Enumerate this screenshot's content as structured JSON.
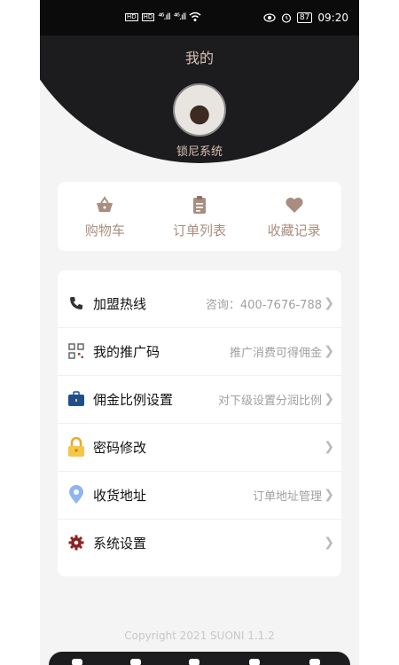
{
  "status_bar": {
    "network_labels": [
      "HD",
      "HD"
    ],
    "signal_1": "⁴⁶.ıll",
    "signal_2": "⁴⁶.ıll",
    "battery": "87",
    "time": "09:20",
    "icons": [
      "eye-icon",
      "alarm-icon",
      "wifi-icon",
      "battery-icon"
    ]
  },
  "header": {
    "title": "我的",
    "username": "锁尼系统"
  },
  "quick_actions": [
    {
      "label": "购物车",
      "icon": "basket-icon"
    },
    {
      "label": "订单列表",
      "icon": "clipboard-icon"
    },
    {
      "label": "收藏记录",
      "icon": "heart-icon"
    }
  ],
  "menu": [
    {
      "label": "加盟热线",
      "sub": "咨询：400-7676-788",
      "icon": "phone-icon"
    },
    {
      "label": "我的推广码",
      "sub": "推广消费可得佣金",
      "icon": "qrcode-icon"
    },
    {
      "label": "佣金比例设置",
      "sub": "对下级设置分润比例",
      "icon": "briefcase-icon"
    },
    {
      "label": "密码修改",
      "sub": "",
      "icon": "lock-icon"
    },
    {
      "label": "收货地址",
      "sub": "订单地址管理",
      "icon": "location-pin-icon"
    },
    {
      "label": "系统设置",
      "sub": "",
      "icon": "gear-icon"
    }
  ],
  "footer": "Copyright 2021 SUONI 1.1.2",
  "colors": {
    "header_bg": "#1c1c1f",
    "accent": "#a88e80",
    "page_bg": "#f4f4f4"
  }
}
